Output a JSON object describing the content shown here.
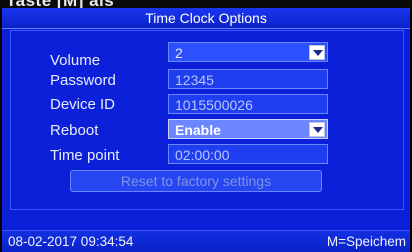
{
  "overlay_caption": "Taste [M] als",
  "window": {
    "title": "Time Clock Options"
  },
  "settings": [
    {
      "label": "Volume",
      "value": "2",
      "kind": "select"
    },
    {
      "label": "Password",
      "value": "12345",
      "kind": "text"
    },
    {
      "label": "Device ID",
      "value": "1015500026",
      "kind": "text"
    },
    {
      "label": "Reboot",
      "value": "Enable",
      "kind": "select",
      "selected": true
    },
    {
      "label": "Time point",
      "value": "02:00:00",
      "kind": "text"
    }
  ],
  "actions": {
    "reset_label": "Reset to factory settings"
  },
  "status": {
    "datetime": "08-02-2017  09:34:54",
    "hint": "M=Speichem"
  },
  "colors": {
    "screen_bg": "#0b20d8",
    "field_bg": "#2346f5",
    "active_field_bg": "#6c86ff",
    "text": "#e9ecff"
  }
}
